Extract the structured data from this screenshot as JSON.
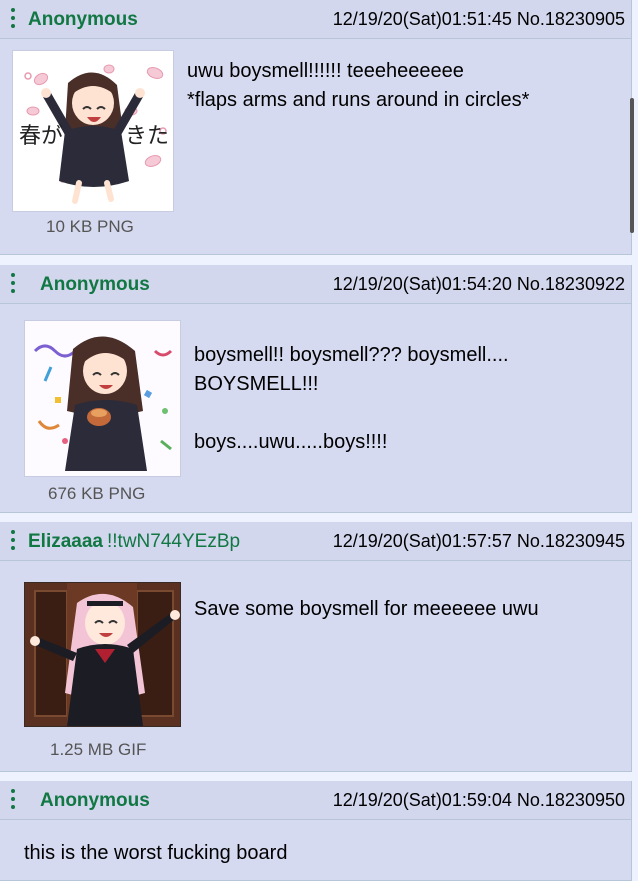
{
  "posts": [
    {
      "name": "Anonymous",
      "tripcode": "",
      "datetime": "12/19/20(Sat)01:51:45",
      "post_no": "No.18230905",
      "file_info": "10 KB PNG",
      "thumb_caption_left": "春が",
      "thumb_caption_right": "きた",
      "comment_lines": [
        "uwu boysmell!!!!!! teeeheeeeee",
        "*flaps arms and runs around in circles*"
      ]
    },
    {
      "name": "Anonymous",
      "tripcode": "",
      "datetime": "12/19/20(Sat)01:54:20",
      "post_no": "No.18230922",
      "file_info": "676 KB PNG",
      "comment_lines": [
        "boysmell!! boysmell??? boysmell....",
        "BOYSMELL!!!",
        "",
        "boys....uwu.....boys!!!!"
      ]
    },
    {
      "name": "Elizaaaa",
      "tripcode": "!!twN744YEzBp",
      "datetime": "12/19/20(Sat)01:57:57",
      "post_no": "No.18230945",
      "file_info": "1.25 MB GIF",
      "comment_lines": [
        "Save some boysmell for meeeeee uwu"
      ]
    },
    {
      "name": "Anonymous",
      "tripcode": "",
      "datetime": "12/19/20(Sat)01:59:04",
      "post_no": "No.18230950",
      "comment_lines": [
        "this is the worst fucking board"
      ]
    }
  ],
  "colors": {
    "post_bg": "#d6daf0",
    "name": "#117743",
    "border": "#b7c5d9"
  }
}
